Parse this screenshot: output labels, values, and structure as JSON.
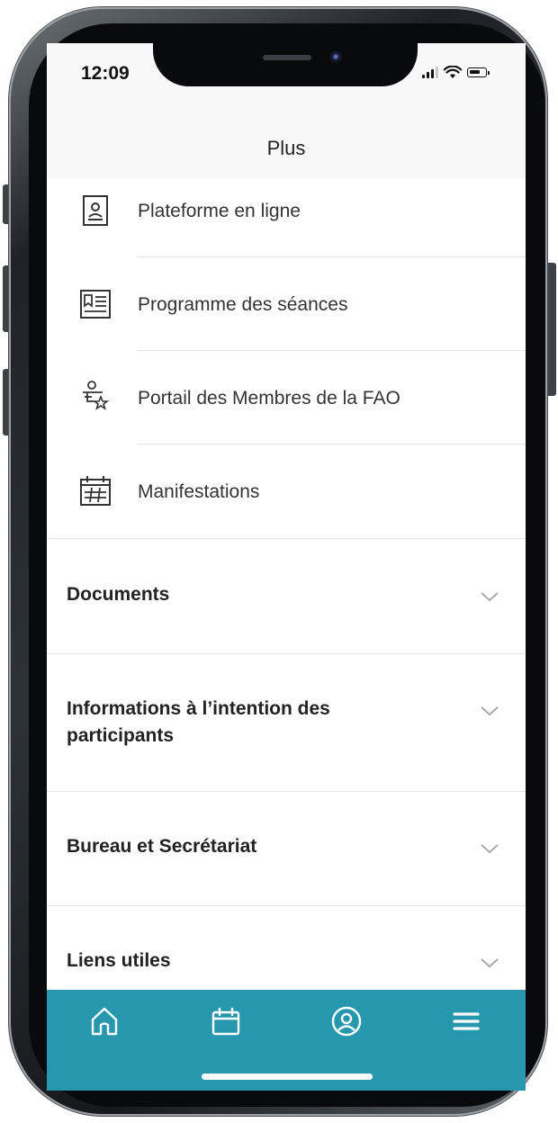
{
  "status_bar": {
    "time": "12:09"
  },
  "header": {
    "title": "Plus"
  },
  "menu": {
    "items": [
      {
        "label": "Plateforme en ligne",
        "icon": "badge-icon"
      },
      {
        "label": "Programme des séances",
        "icon": "newspaper-icon"
      },
      {
        "label": "Portail des Membres de la FAO",
        "icon": "member-star-icon"
      },
      {
        "label": "Manifestations",
        "icon": "calendar-grid-icon"
      }
    ]
  },
  "sections": [
    {
      "title": "Documents"
    },
    {
      "title": "Informations à l’intention des participants"
    },
    {
      "title": "Bureau et Secrétariat"
    },
    {
      "title": "Liens utiles"
    }
  ],
  "tabbar": {
    "tabs": [
      {
        "icon": "home-icon"
      },
      {
        "icon": "calendar-icon"
      },
      {
        "icon": "profile-icon"
      },
      {
        "icon": "menu-icon"
      }
    ]
  },
  "colors": {
    "accent": "#2797ad",
    "text": "#333333",
    "divider": "#e6e6e6"
  }
}
